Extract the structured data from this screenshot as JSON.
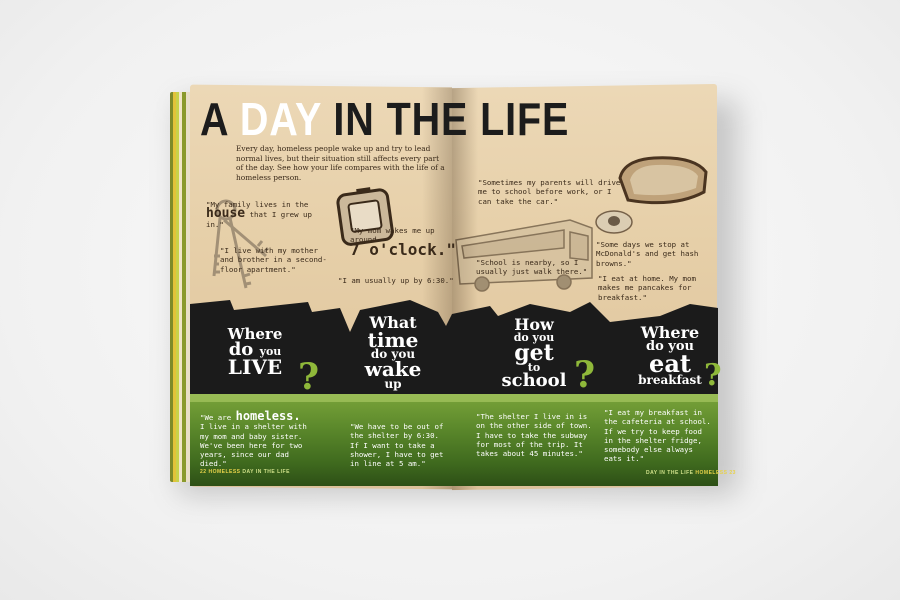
{
  "title": {
    "part1": "A ",
    "highlight": "DAY",
    "part2": " IN THE LIFE"
  },
  "intro": "Every day, homeless people wake up and try to lead normal lives, but their situation still affects every part of the day. See how your life compares with the life of a homeless person.",
  "quotes": {
    "house_pre": "\"My family lives in the",
    "house_big": "house",
    "house_post": "that I grew up in.\"",
    "mother": "\"I live with my mother and brother in a second-floor apartment.\"",
    "wake_pre": "\"My mom wakes me up around",
    "wake_big": "7 o'clock.\"",
    "up_by": "\"I am usually up by 6:30.\"",
    "drive": "\"Sometimes my parents will drive me to school before work, or I can take the car.\"",
    "walk": "\"School is nearby, so I usually just walk there.\"",
    "mcdonalds": "\"Some days we stop at McDonald's and get hash browns.\"",
    "pancakes": "\"I eat at home. My mom makes me pancakes for breakfast.\""
  },
  "questions": {
    "live": {
      "l1": "Where",
      "l2": "do",
      "l2b": "you",
      "l3": "LIVE"
    },
    "wake": {
      "l1": "What",
      "l2": "time",
      "l3": "do you",
      "l4": "wake",
      "l5": "up"
    },
    "school": {
      "l1": "How",
      "l2": "do you",
      "l3": "get",
      "l4": "to",
      "l5": "school"
    },
    "breakfast": {
      "l1": "Where",
      "l2": "do you",
      "l3": "eat",
      "l4": "breakfast"
    },
    "mark": "?"
  },
  "answers": {
    "homeless_pre": "\"We are",
    "homeless_big": "homeless.",
    "homeless_post": "I live in a shelter with my mom and baby sister. We've been here for two years, since our dad died.\"",
    "shelter_time": "\"We have to be out of the shelter by 6:30. If I want to take a shower, I have to get in line at 5 am.\"",
    "subway": "\"The shelter I live in is on the other side of town. I have to take the subway for most of the trip. It takes about 45 minutes.\"",
    "cafeteria": "\"I eat my breakfast in the cafeteria at school. If we try to keep food in the shelter fridge, somebody else always eats it.\""
  },
  "footer": {
    "left_num": "22",
    "left_label": "HOMELESS",
    "left_section": "DAY IN THE LIFE",
    "right_section": "DAY IN THE LIFE",
    "right_label": "HOMELESS",
    "right_num": "23"
  },
  "colors": {
    "paper": "#e6cfa8",
    "black_band": "#1b1b1b",
    "green": "#5d8a2c",
    "accent_question": "#8fb83a",
    "footer": "#e8d24a"
  },
  "icons": [
    "keys-icon",
    "alarm-clock-icon",
    "school-bus-icon",
    "toast-icon",
    "egg-icon"
  ]
}
